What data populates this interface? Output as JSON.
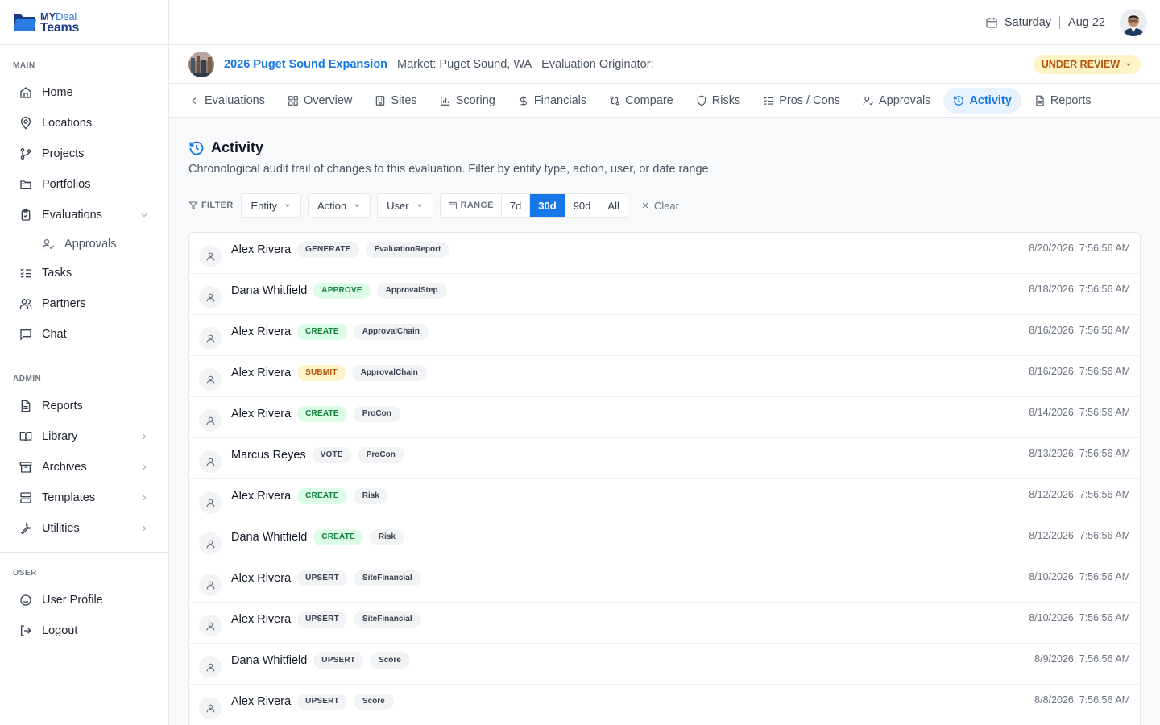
{
  "brand": {
    "my": "MY",
    "deal": "Deal",
    "teams": "Teams"
  },
  "sidebar": {
    "main_label": "MAIN",
    "main_items": [
      {
        "label": "Home",
        "icon": "home-icon"
      },
      {
        "label": "Locations",
        "icon": "map-pin-icon"
      },
      {
        "label": "Projects",
        "icon": "git-branch-icon"
      },
      {
        "label": "Portfolios",
        "icon": "folder-icon"
      },
      {
        "label": "Evaluations",
        "icon": "clipboard-icon",
        "expanded": true
      },
      {
        "label": "Approvals",
        "icon": "user-check-icon",
        "sub": true
      },
      {
        "label": "Tasks",
        "icon": "list-checks-icon"
      },
      {
        "label": "Partners",
        "icon": "users-icon"
      },
      {
        "label": "Chat",
        "icon": "message-square-icon"
      }
    ],
    "admin_label": "ADMIN",
    "admin_items": [
      {
        "label": "Reports",
        "icon": "file-text-icon"
      },
      {
        "label": "Library",
        "icon": "book-open-icon"
      },
      {
        "label": "Archives",
        "icon": "archive-icon"
      },
      {
        "label": "Templates",
        "icon": "layout-icon"
      },
      {
        "label": "Utilities",
        "icon": "wrench-icon"
      }
    ],
    "user_label": "USER",
    "user_items": [
      {
        "label": "User Profile",
        "icon": "smile-icon"
      },
      {
        "label": "Logout",
        "icon": "logout-icon"
      }
    ]
  },
  "topbar": {
    "day": "Saturday",
    "date": "Aug 22"
  },
  "evaluation": {
    "title": "2026 Puget Sound Expansion",
    "market": "Market: Puget Sound, WA",
    "originator": "Evaluation Originator:",
    "status": "UNDER REVIEW"
  },
  "tabs": [
    {
      "label": "Evaluations",
      "icon": "chevron-left-icon"
    },
    {
      "label": "Overview",
      "icon": "grid-icon"
    },
    {
      "label": "Sites",
      "icon": "building-icon"
    },
    {
      "label": "Scoring",
      "icon": "bar-chart-icon"
    },
    {
      "label": "Financials",
      "icon": "dollar-icon"
    },
    {
      "label": "Compare",
      "icon": "compare-icon"
    },
    {
      "label": "Risks",
      "icon": "shield-icon"
    },
    {
      "label": "Pros / Cons",
      "icon": "list-checks-icon"
    },
    {
      "label": "Approvals",
      "icon": "user-check-icon"
    },
    {
      "label": "Activity",
      "icon": "history-icon",
      "active": true
    },
    {
      "label": "Reports",
      "icon": "file-text-icon"
    }
  ],
  "page": {
    "title": "Activity",
    "description": "Chronological audit trail of changes to this evaluation. Filter by entity type, action, user, or date range."
  },
  "filters": {
    "label": "FILTER",
    "entity": "Entity",
    "action": "Action",
    "user": "User",
    "range_label": "RANGE",
    "ranges": [
      "7d",
      "30d",
      "90d",
      "All"
    ],
    "active_range": "30d",
    "clear": "Clear"
  },
  "colors": {
    "accent": "#1677e8",
    "status_bg": "#fdf3c7",
    "status_fg": "#b45309",
    "green_bg": "#dcfce7",
    "green_fg": "#15803d"
  },
  "activity": [
    {
      "user": "Alex Rivera",
      "action": "GENERATE",
      "tone": "gray",
      "entity": "EvaluationReport",
      "time": "8/20/2026, 7:56:56 AM"
    },
    {
      "user": "Dana Whitfield",
      "action": "APPROVE",
      "tone": "green",
      "entity": "ApprovalStep",
      "time": "8/18/2026, 7:56:56 AM"
    },
    {
      "user": "Alex Rivera",
      "action": "CREATE",
      "tone": "green",
      "entity": "ApprovalChain",
      "time": "8/16/2026, 7:56:56 AM"
    },
    {
      "user": "Alex Rivera",
      "action": "SUBMIT",
      "tone": "yellow",
      "entity": "ApprovalChain",
      "time": "8/16/2026, 7:56:56 AM"
    },
    {
      "user": "Alex Rivera",
      "action": "CREATE",
      "tone": "green",
      "entity": "ProCon",
      "time": "8/14/2026, 7:56:56 AM"
    },
    {
      "user": "Marcus Reyes",
      "action": "VOTE",
      "tone": "gray",
      "entity": "ProCon",
      "time": "8/13/2026, 7:56:56 AM"
    },
    {
      "user": "Alex Rivera",
      "action": "CREATE",
      "tone": "green",
      "entity": "Risk",
      "time": "8/12/2026, 7:56:56 AM"
    },
    {
      "user": "Dana Whitfield",
      "action": "CREATE",
      "tone": "green",
      "entity": "Risk",
      "time": "8/12/2026, 7:56:56 AM"
    },
    {
      "user": "Alex Rivera",
      "action": "UPSERT",
      "tone": "gray",
      "entity": "SiteFinancial",
      "time": "8/10/2026, 7:56:56 AM"
    },
    {
      "user": "Alex Rivera",
      "action": "UPSERT",
      "tone": "gray",
      "entity": "SiteFinancial",
      "time": "8/10/2026, 7:56:56 AM"
    },
    {
      "user": "Dana Whitfield",
      "action": "UPSERT",
      "tone": "gray",
      "entity": "Score",
      "time": "8/9/2026, 7:56:56 AM"
    },
    {
      "user": "Alex Rivera",
      "action": "UPSERT",
      "tone": "gray",
      "entity": "Score",
      "time": "8/8/2026, 7:56:56 AM"
    }
  ]
}
